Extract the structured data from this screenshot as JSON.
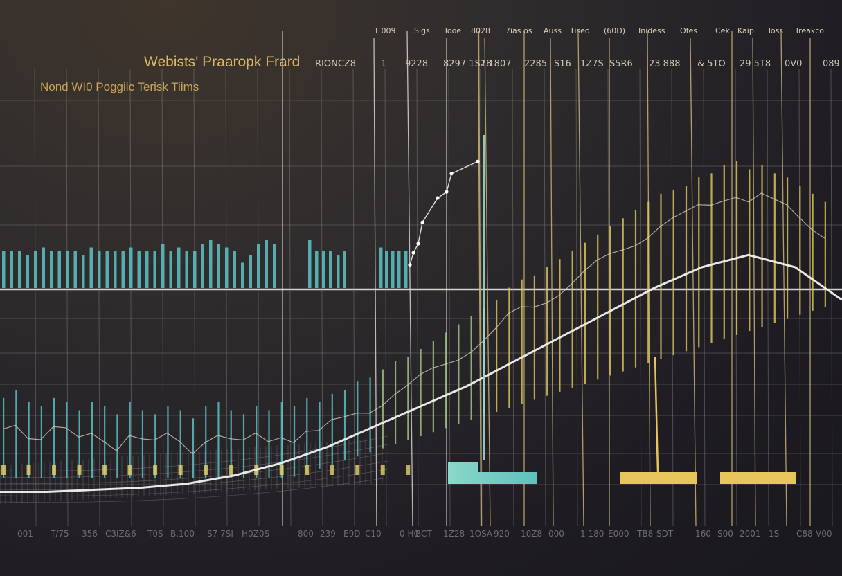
{
  "chart_data": {
    "type": "bar",
    "title": "Webists' Praaropk Frard",
    "subtitle": "Nond WI0 Poggiic Terisk Tiims",
    "header_row_labels": [
      "1 009",
      "Sigs",
      "Tooe",
      "8028",
      "7ias os",
      "Auss",
      "Tiseo",
      "(60D)",
      "Inidess",
      "Ofes",
      "Cek",
      "Kaip",
      "Toss",
      "Treakco"
    ],
    "value_row_labels": [
      "RIONCZ8",
      "1",
      "9228",
      "8297 1S18",
      "2.1807",
      "2285",
      "S16",
      "1Z7S",
      "S5R6",
      "23 888",
      "& 5TO",
      "29 5T8",
      "0V0",
      "089"
    ],
    "x_tick_labels": [
      "001",
      "T/75",
      "356",
      "C3IZ&6",
      "T0S",
      "B.100",
      "S7 7SI",
      "H0Z0S",
      "800",
      "239",
      "E9D",
      "C10",
      "0 H0",
      "BCT",
      "1Z28",
      "1OSA",
      "920",
      "10Z8",
      "000",
      "1 180",
      "E000",
      "TB8",
      "SDT",
      "160",
      "S00",
      "2001",
      "1S",
      "C88",
      "V00"
    ],
    "grid": true,
    "legend": "none",
    "ylim": [
      0,
      100
    ],
    "series": [
      {
        "name": "teal-band",
        "color": "#5bbfc2",
        "values": [
          55,
          55,
          55,
          54,
          55,
          56,
          55,
          55,
          55,
          55,
          54,
          56,
          55,
          55,
          55,
          55,
          56,
          55,
          55,
          55,
          57,
          55,
          56,
          55,
          55,
          57,
          58,
          57,
          56,
          55,
          52,
          54,
          57,
          58,
          57,
          58
        ]
      },
      {
        "name": "wave-bars",
        "color_start": "#5bbfc2",
        "color_end": "#d8c45c",
        "values": [
          28,
          30,
          27,
          26,
          28,
          27,
          25,
          27,
          26,
          24,
          27,
          25,
          24,
          26,
          25,
          23,
          26,
          27,
          25,
          24,
          26,
          25,
          27,
          26,
          28,
          27,
          29,
          30,
          32,
          33,
          35,
          37,
          38,
          40,
          42,
          44,
          46,
          48,
          50,
          52,
          55,
          57,
          58,
          60,
          62,
          64,
          66,
          68,
          70,
          72,
          74,
          76,
          78,
          79,
          80,
          82,
          83,
          85,
          86,
          84,
          85,
          83,
          82,
          80,
          78,
          76
        ]
      },
      {
        "name": "trend-line",
        "color": "#f2f2f0",
        "values": [
          5,
          5,
          5.5,
          6,
          7,
          9,
          12,
          16,
          21,
          26,
          31,
          37,
          43,
          49,
          55,
          60,
          63,
          60,
          52
        ]
      },
      {
        "name": "spike-markers",
        "color": "#ffffff",
        "values": [
          58,
          62,
          65,
          72,
          80,
          82,
          88,
          92
        ]
      }
    ],
    "floor_blocks": [
      {
        "label": "teal-block",
        "color": "#72cbbd",
        "value": 4
      },
      {
        "label": "gold-block-1",
        "color": "#e8c55a",
        "value": 3
      },
      {
        "label": "gold-block-2",
        "color": "#e8c55a",
        "value": 3
      }
    ]
  }
}
